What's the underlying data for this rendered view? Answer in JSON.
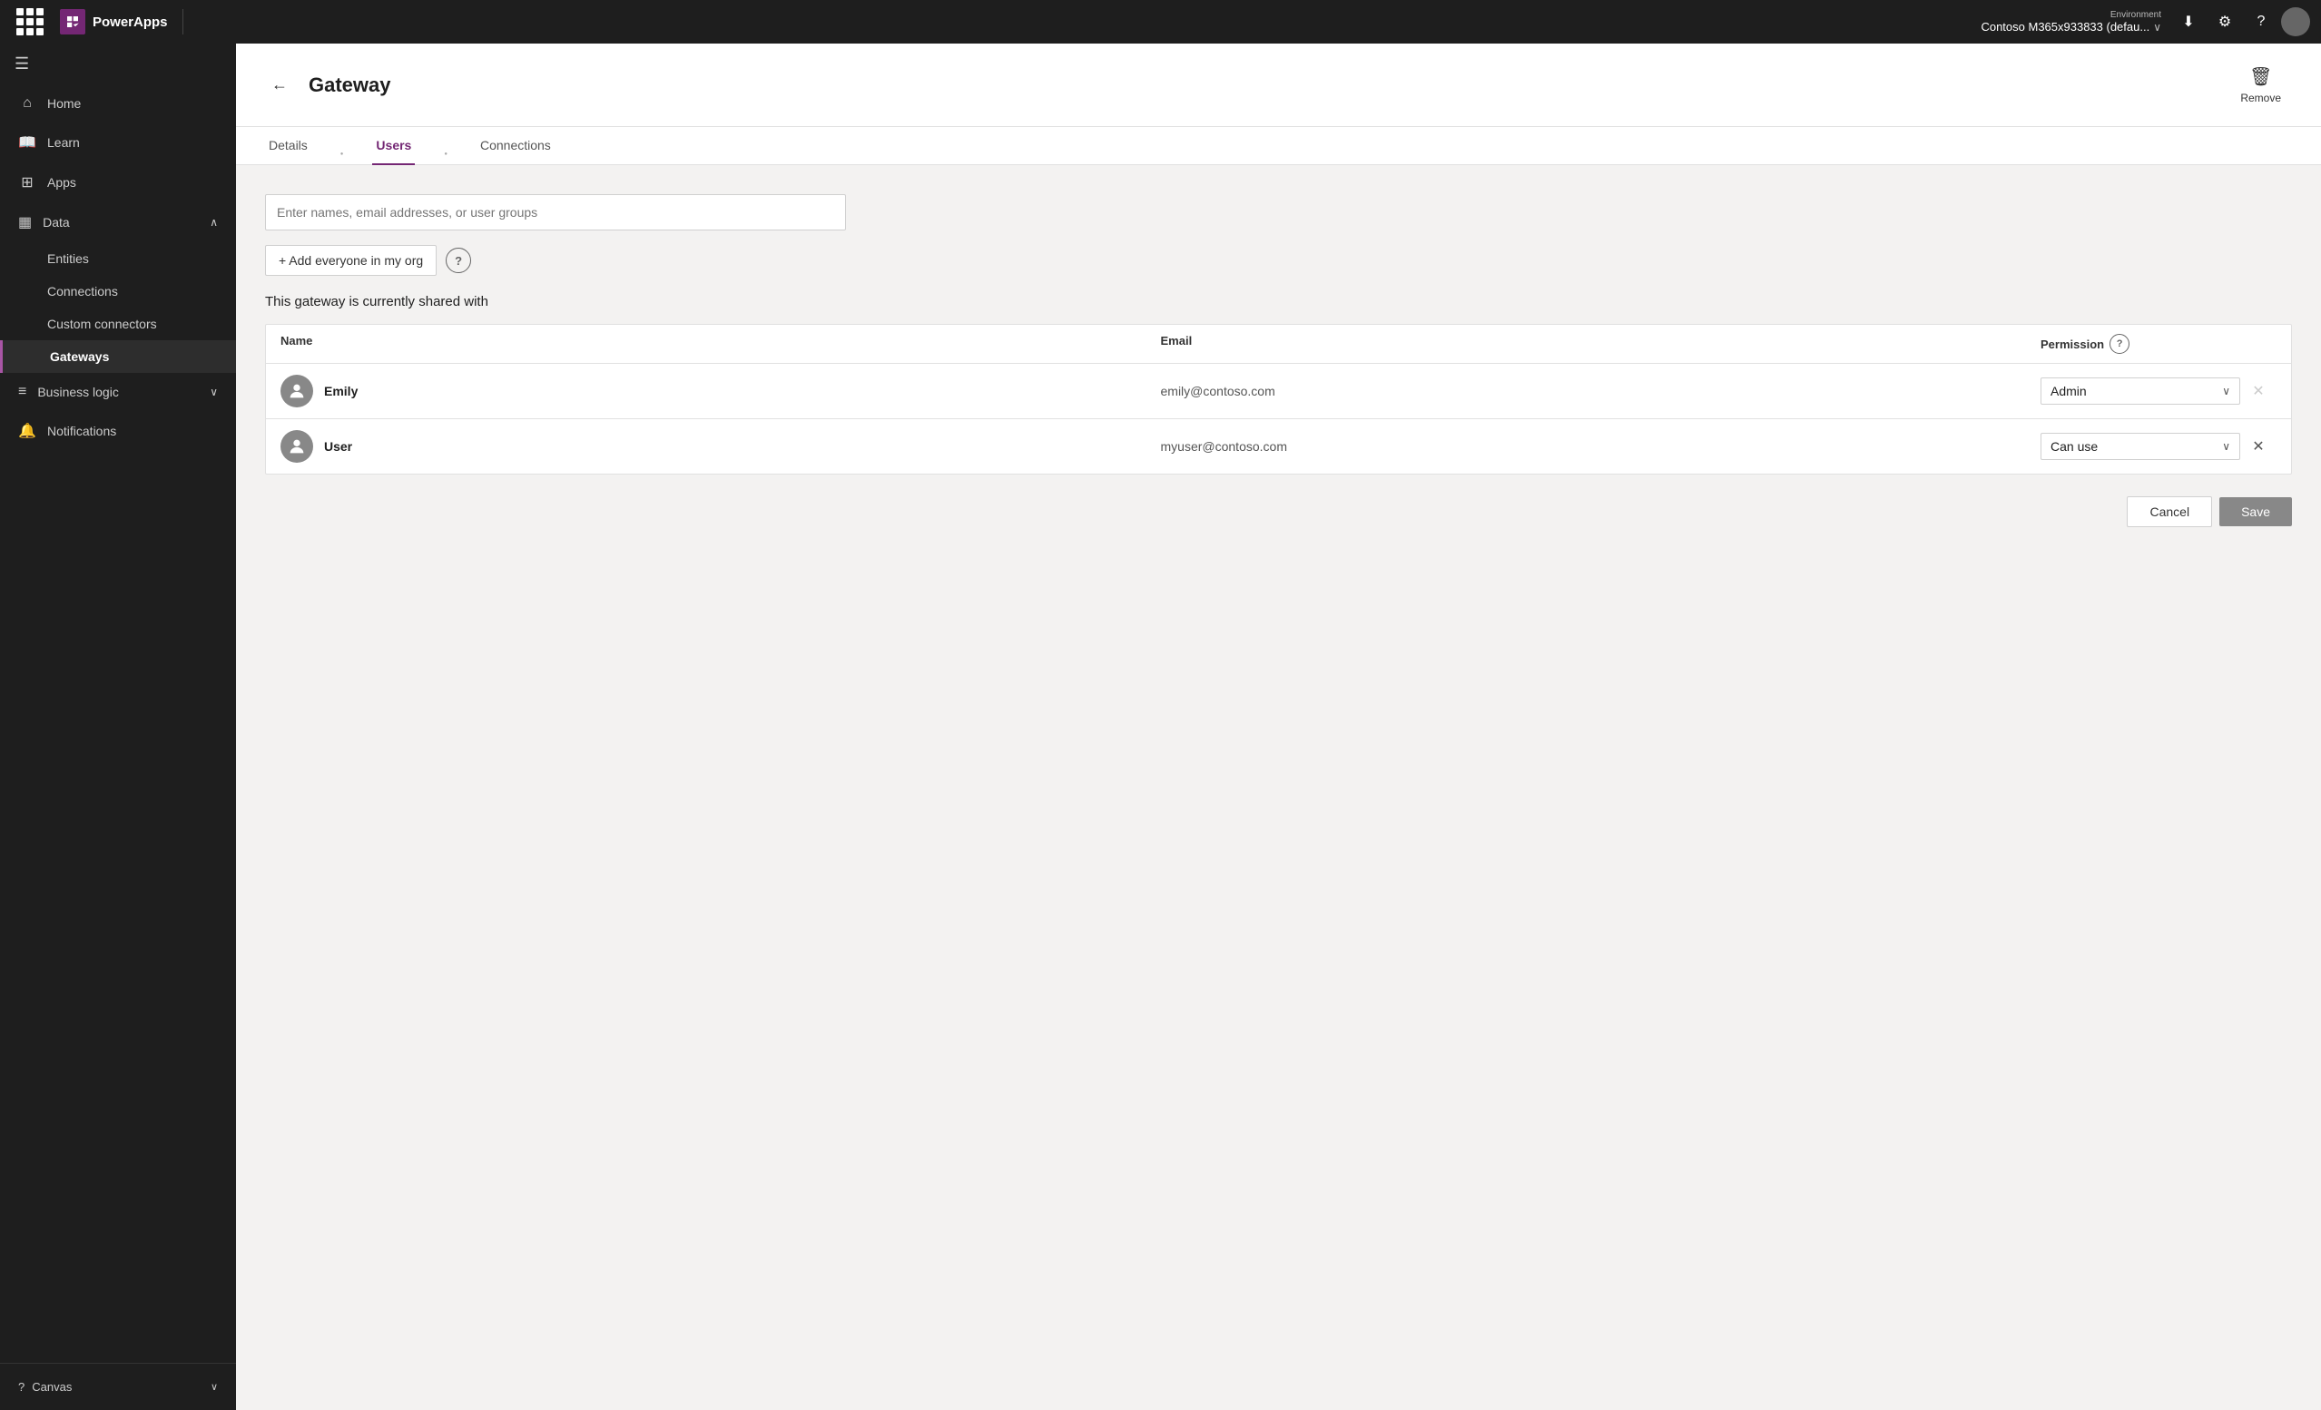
{
  "topNav": {
    "appName": "PowerApps",
    "environment": {
      "label": "Environment",
      "name": "Contoso M365x933833 (defau..."
    },
    "icons": {
      "download": "⬇",
      "settings": "⚙",
      "help": "?",
      "chevronDown": "∨"
    }
  },
  "sidebar": {
    "items": [
      {
        "id": "home",
        "label": "Home",
        "icon": "⌂"
      },
      {
        "id": "learn",
        "label": "Learn",
        "icon": "📖"
      },
      {
        "id": "apps",
        "label": "Apps",
        "icon": "⊞"
      }
    ],
    "sections": [
      {
        "id": "data",
        "label": "Data",
        "icon": "▦",
        "expanded": true,
        "subItems": [
          {
            "id": "entities",
            "label": "Entities"
          },
          {
            "id": "connections",
            "label": "Connections"
          },
          {
            "id": "custom-connectors",
            "label": "Custom connectors"
          },
          {
            "id": "gateways",
            "label": "Gateways",
            "active": true
          }
        ]
      },
      {
        "id": "business-logic",
        "label": "Business logic",
        "icon": "≡",
        "expanded": false,
        "subItems": []
      }
    ],
    "extraItems": [
      {
        "id": "notifications",
        "label": "Notifications",
        "icon": "🔔"
      }
    ],
    "footer": {
      "label": "Canvas",
      "icon": "?"
    }
  },
  "page": {
    "title": "Gateway",
    "backLabel": "←",
    "removeLabel": "Remove",
    "removeIcon": "🗑"
  },
  "tabs": [
    {
      "id": "details",
      "label": "Details",
      "active": false
    },
    {
      "id": "users",
      "label": "Users",
      "active": true
    },
    {
      "id": "connections",
      "label": "Connections",
      "active": false
    }
  ],
  "usersTab": {
    "searchPlaceholder": "Enter names, email addresses, or user groups",
    "addEveryoneLabel": "+ Add everyone in my org",
    "helpIcon": "?",
    "sharedText": "This gateway is currently shared with",
    "table": {
      "headers": {
        "name": "Name",
        "email": "Email",
        "permission": "Permission"
      },
      "rows": [
        {
          "name": "Emily",
          "email": "emily@contoso.com",
          "permission": "Admin",
          "canDelete": false
        },
        {
          "name": "User",
          "email": "myuser@contoso.com",
          "permission": "Can use",
          "canDelete": true
        }
      ]
    },
    "cancelLabel": "Cancel",
    "saveLabel": "Save"
  }
}
